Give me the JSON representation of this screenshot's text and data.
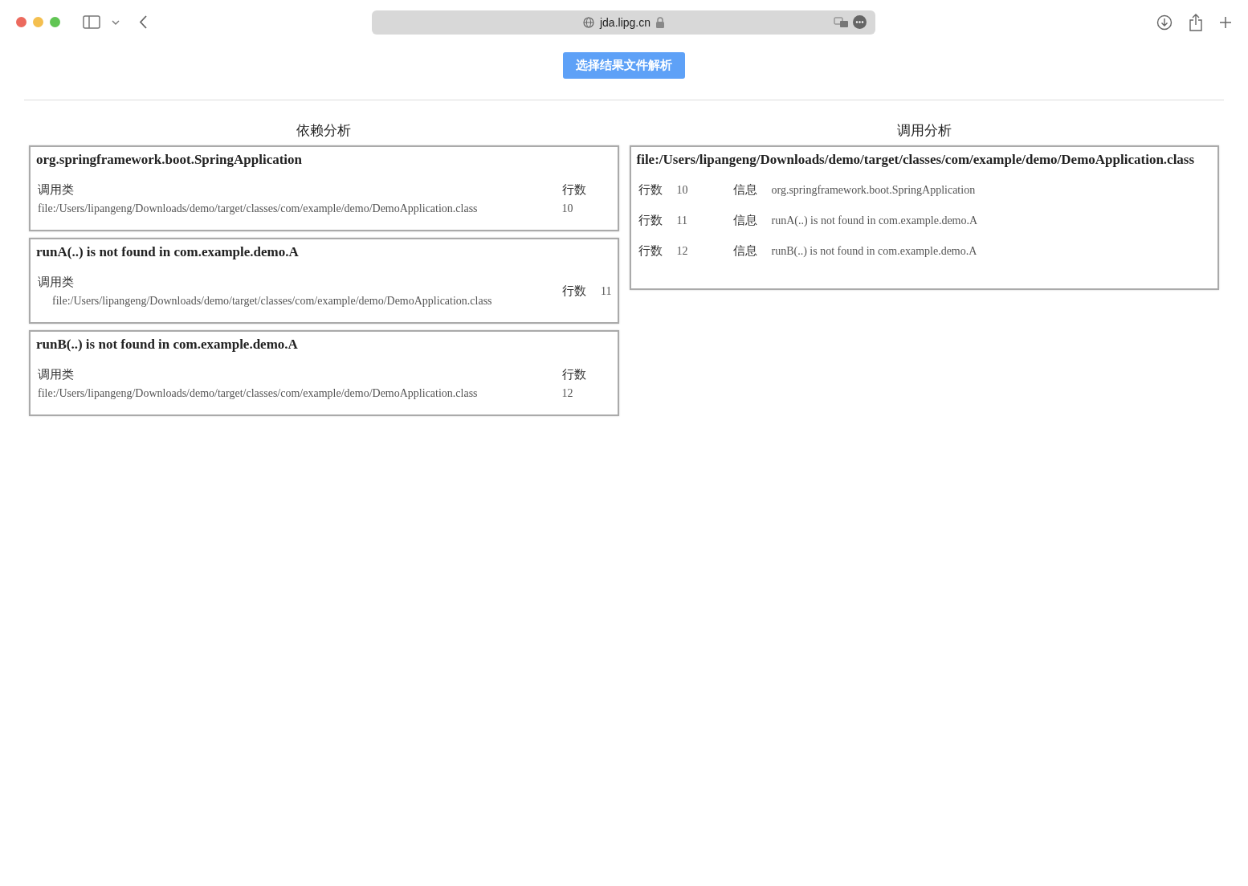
{
  "browser": {
    "address": "jda.lipg.cn"
  },
  "toolbar": {
    "button": "选择结果文件解析"
  },
  "dependency_panel": {
    "heading": "依赖分析",
    "cards": [
      {
        "kind": "stacked",
        "title": "org.springframework.boot.SpringApplication",
        "caller_label": "调用类",
        "caller": "file:/Users/lipangeng/Downloads/demo/target/classes/com/example/demo/DemoApplication.class",
        "line_label": "行数",
        "line": "10"
      },
      {
        "kind": "inline",
        "title": "runA(..) is not found in com.example.demo.A",
        "caller_label": "调用类",
        "caller": "file:/Users/lipangeng/Downloads/demo/target/classes/com/example/demo/DemoApplication.class",
        "line_label": "行数",
        "line": "11"
      },
      {
        "kind": "stacked",
        "title": "runB(..) is not found in com.example.demo.A",
        "caller_label": "调用类",
        "caller": "file:/Users/lipangeng/Downloads/demo/target/classes/com/example/demo/DemoApplication.class",
        "line_label": "行数",
        "line": "12"
      }
    ]
  },
  "call_panel": {
    "heading": "调用分析",
    "cards": [
      {
        "title": "file:/Users/lipangeng/Downloads/demo/target/classes/com/example/demo/DemoApplication.class",
        "rows": [
          {
            "line_label": "行数",
            "line": "10",
            "info_label": "信息",
            "info": "org.springframework.boot.SpringApplication"
          },
          {
            "line_label": "行数",
            "line": "11",
            "info_label": "信息",
            "info": "runA(..) is not found in com.example.demo.A"
          },
          {
            "line_label": "行数",
            "line": "12",
            "info_label": "信息",
            "info": "runB(..) is not found in com.example.demo.A"
          }
        ]
      }
    ]
  }
}
